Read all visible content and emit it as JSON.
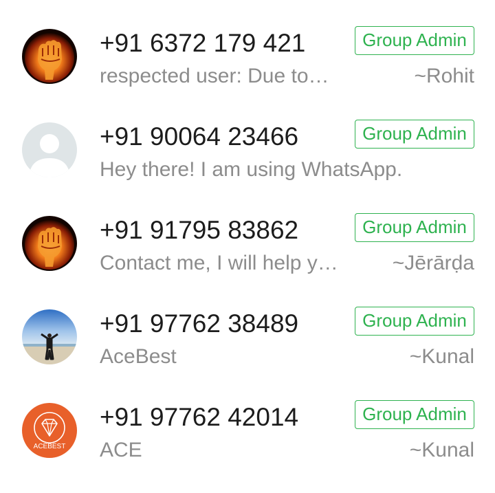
{
  "participants": [
    {
      "phone": "+91 6372 179 421",
      "badge": "Group Admin",
      "about": "respected user:        Due to…",
      "push_name": "~Rohit",
      "avatar": "fist-fire-avatar"
    },
    {
      "phone": "+91 90064 23466",
      "badge": "Group Admin",
      "about": "Hey there! I am using WhatsApp.",
      "push_name": "",
      "avatar": "default-user-avatar"
    },
    {
      "phone": "+91 91795 83862",
      "badge": "Group Admin",
      "about": "Contact me, I will help y…",
      "push_name": "~Jērārḍa",
      "avatar": "fist-fire-avatar"
    },
    {
      "phone": "+91 97762 38489",
      "badge": "Group Admin",
      "about": "AceBest",
      "push_name": "~Kunal",
      "avatar": "beach-person-avatar"
    },
    {
      "phone": "+91 97762 42014",
      "badge": "Group Admin",
      "about": "ACE",
      "push_name": "~Kunal",
      "avatar": "acebest-logo-avatar",
      "avatar_logo_text": "ACEBEST"
    }
  ],
  "colors": {
    "badge_green": "#2eb24f",
    "secondary_text": "#8c8c8c",
    "primary_text": "#1c1c1c",
    "logo_orange": "#e8602a"
  }
}
